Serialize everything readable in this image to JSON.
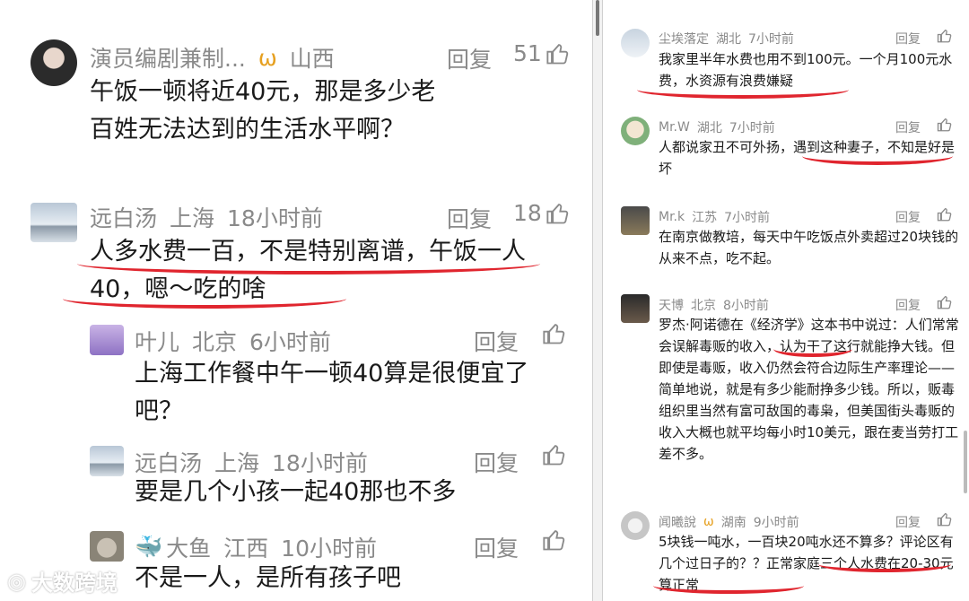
{
  "left": {
    "comments": [
      {
        "user": "演员编剧兼制...",
        "badge": "ω",
        "region": "山西",
        "time": "",
        "reply": "回复",
        "likes": "51",
        "text": "午饭一顿将近40元，那是多少老百姓无法达到的生活水平啊？"
      },
      {
        "user": "远白汤",
        "region": "上海",
        "time": "18小时前",
        "reply": "回复",
        "likes": "18",
        "text": "人多水费一百，不是特别离谱，午饭一人40，嗯～吃的啥"
      },
      {
        "user": "叶儿",
        "region": "北京",
        "time": "6小时前",
        "reply": "回复",
        "text": "上海工作餐中午一顿40算是很便宜了吧？"
      },
      {
        "user": "远白汤",
        "region": "上海",
        "time": "18小时前",
        "reply": "回复",
        "text": "要是几个小孩一起40那也不多"
      },
      {
        "user": "大鱼",
        "region": "江西",
        "time": "10小时前",
        "reply": "回复",
        "text": "不是一人，是所有孩子吧"
      }
    ]
  },
  "right": {
    "comments": [
      {
        "user": "尘埃落定",
        "region": "湖北",
        "time": "7小时前",
        "reply": "回复",
        "text": "我家里半年水费也用不到100元。一个月100元水费，水资源有浪费嫌疑"
      },
      {
        "user": "Mr.W",
        "region": "湖北",
        "time": "7小时前",
        "reply": "回复",
        "text": "人都说家丑不可外扬，遇到这种妻子，不知是好是坏"
      },
      {
        "user": "Mr.k",
        "region": "江苏",
        "time": "7小时前",
        "reply": "回复",
        "text": "在南京做教培，每天中午吃饭点外卖超过20块钱的从来不点，吃不起。"
      },
      {
        "user": "天博",
        "region": "北京",
        "time": "8小时前",
        "reply": "回复",
        "text": "罗杰·阿诺德在《经济学》这本书中说过：人们常常会误解毒贩的收入，认为干了这行就能挣大钱。但即使是毒贩，收入仍然会符合边际生产率理论——简单地说，就是有多少能耐挣多少钱。所以，贩毒组织里当然有富可敌国的毒枭，但美国街头毒贩的收入大概也就平均每小时10美元，跟在麦当劳打工差不多。"
      },
      {
        "user": "闻曦說",
        "badge": "ω",
        "region": "湖南",
        "time": "9小时前",
        "reply": "回复",
        "text": "5块钱一吨水，一百块20吨水还不算多？评论区有几个过日子的？？正常家庭三个人水费在20-30元算正常"
      }
    ]
  },
  "watermark": "大数跨境"
}
